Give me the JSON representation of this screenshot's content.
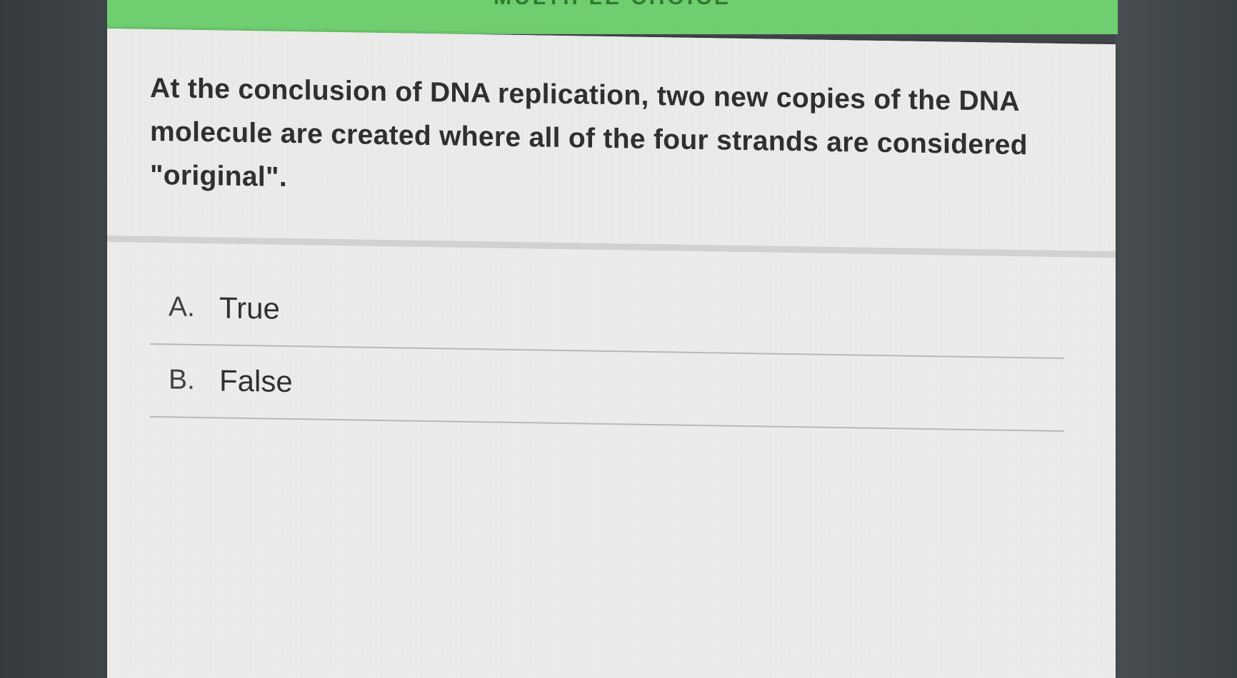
{
  "header": {
    "label": "MULTIPLE CHOICE"
  },
  "question": {
    "text": "At the conclusion of DNA replication, two new copies of the DNA molecule are created where all of the four strands are considered \"original\"."
  },
  "answers": [
    {
      "letter": "A.",
      "label": "True"
    },
    {
      "letter": "B.",
      "label": "False"
    }
  ],
  "colors": {
    "header_green": "#6fce6f",
    "card_background": "#ececec",
    "screen_bezel": "#3d4347"
  }
}
